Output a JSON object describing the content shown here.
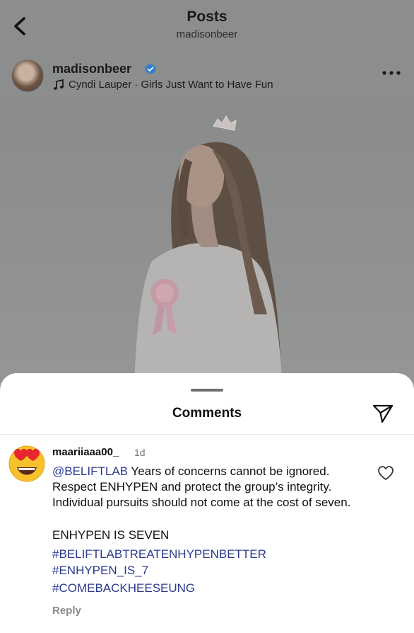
{
  "colors": {
    "dim_overlay": "#8c8e8e",
    "link_blue": "#2b3a8f",
    "verified_blue": "#3897f0",
    "sheet_bg": "#ffffff"
  },
  "header": {
    "title": "Posts",
    "subtitle": "madisonbeer",
    "back_icon": "chevron-left-icon"
  },
  "post": {
    "author": "madisonbeer",
    "verified": true,
    "music_icon": "music-note-icon",
    "music": "Cyndi Lauper · Girls Just Want to Have Fun",
    "more_icon": "ellipsis-icon"
  },
  "comments_sheet": {
    "title": "Comments",
    "share_icon": "paper-plane-icon",
    "comment": {
      "avatar_icon": "heart-eyes-emoji",
      "username": "maariiaaa00_",
      "time": "1d",
      "mention": "@BELIFTLAB",
      "text": " Years of concerns cannot be ignored. Respect ENHYPEN and protect the group’s integrity. Individual pursuits should not come at the cost of seven.",
      "line2": "ENHYPEN IS SEVEN",
      "hashtags": [
        "#BELIFTLABTREATENHYPENBETTER",
        "#ENHYPEN_IS_7",
        "#COMEBACKHEESEUNG"
      ],
      "reply_label": "Reply",
      "like_icon": "heart-outline-icon"
    }
  }
}
